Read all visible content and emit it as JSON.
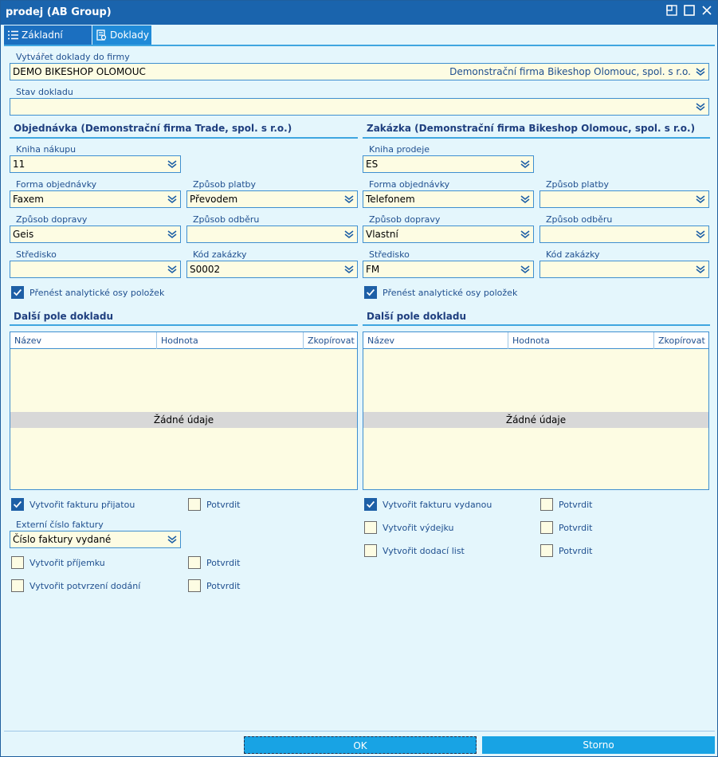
{
  "window": {
    "title": "prodej (AB Group)"
  },
  "tabs": [
    {
      "label": "Základní údaje"
    },
    {
      "label": "Doklady"
    }
  ],
  "firm": {
    "label": "Vytvářet doklady do firmy",
    "value": "DEMO BIKESHOP OLOMOUC",
    "name": "Demonstrační firma Bikeshop Olomouc, spol. s r.o."
  },
  "doc_state": {
    "label": "Stav dokladu",
    "value": ""
  },
  "order": {
    "heading": "Objednávka (Demonstrační firma Trade, spol. s r.o.)",
    "book_label": "Kniha nákupu",
    "book_value": "11",
    "form_label": "Forma objednávky",
    "form_value": "Faxem",
    "payment_label": "Způsob platby",
    "payment_value": "Převodem",
    "transport_label": "Způsob dopravy",
    "transport_value": "Geis",
    "pickup_label": "Způsob odběru",
    "pickup_value": "",
    "center_label": "Středisko",
    "center_value": "",
    "contract_label": "Kód zakázky",
    "contract_value": "S0002",
    "transfer_label": "Přenést analytické osy položek"
  },
  "contract": {
    "heading": "Zakázka (Demonstrační firma Bikeshop Olomouc, spol. s r.o.)",
    "book_label": "Kniha prodeje",
    "book_value": "ES",
    "form_label": "Forma objednávky",
    "form_value": "Telefonem",
    "payment_label": "Způsob platby",
    "payment_value": "",
    "transport_label": "Způsob dopravy",
    "transport_value": "Vlastní",
    "pickup_label": "Způsob odběru",
    "pickup_value": "",
    "center_label": "Středisko",
    "center_value": "FM",
    "contract_label": "Kód zakázky",
    "contract_value": "",
    "transfer_label": "Přenést analytické osy položek"
  },
  "extra_left": {
    "heading": "Další pole dokladu",
    "col_name": "Název",
    "col_value": "Hodnota",
    "col_copy": "Zkopírovat",
    "empty": "Žádné údaje"
  },
  "extra_right": {
    "heading": "Další pole dokladu",
    "col_name": "Název",
    "col_value": "Hodnota",
    "col_copy": "Zkopírovat",
    "empty": "Žádné údaje"
  },
  "left_opts": {
    "invoice_in": "Vytvořit fakturu přijatou",
    "confirm": "Potvrdit",
    "ext_label": "Externí číslo faktury",
    "ext_value": "Číslo faktury vydané",
    "receipt": "Vytvořit příjemku",
    "delivery_confirm": "Vytvořit potvrzení dodání"
  },
  "right_opts": {
    "invoice_out": "Vytvořit fakturu vydanou",
    "confirm": "Potvrdit",
    "dispatch": "Vytvořit výdejku",
    "delivery_note": "Vytvořit dodací list"
  },
  "buttons": {
    "ok": "OK",
    "cancel": "Storno"
  },
  "colors": {
    "titlebar": "#1a64ad",
    "accent": "#18a3e4",
    "field": "#fdfce3"
  }
}
